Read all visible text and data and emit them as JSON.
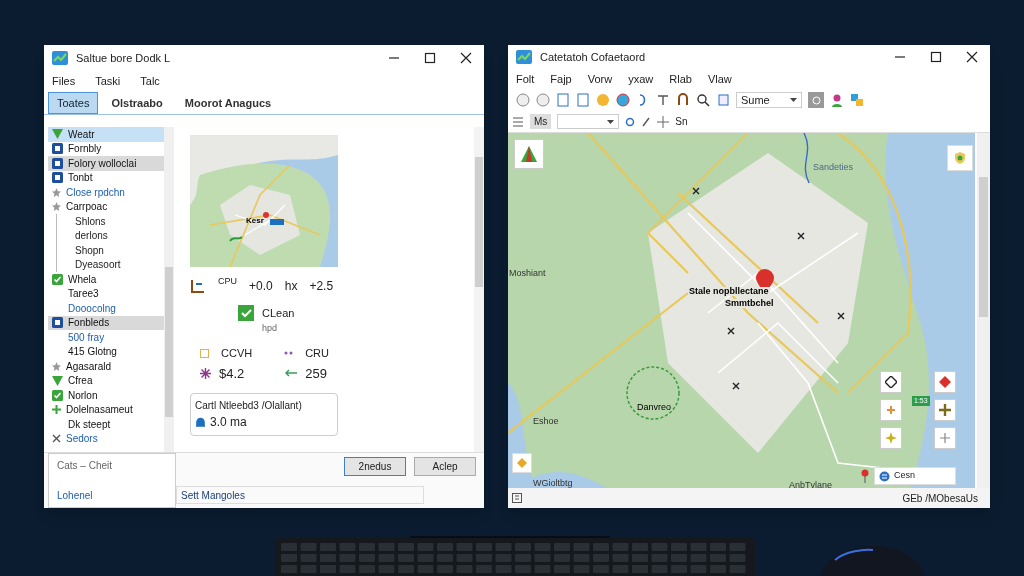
{
  "left_window": {
    "title": "Saltue bore Dodk L",
    "menu": [
      "Files",
      "Taski",
      "Talc"
    ],
    "tabs": [
      {
        "label": "Toates",
        "selected": true
      },
      {
        "label": "Olstraabo",
        "selected": false
      },
      {
        "label": "Moorot Anagucs",
        "selected": false
      }
    ],
    "tree": [
      {
        "label": "Weatr",
        "kind": "triangle",
        "selected": true,
        "highlighted": false,
        "link": false
      },
      {
        "label": "Fornbly",
        "kind": "square",
        "selected": false,
        "highlighted": false,
        "link": false
      },
      {
        "label": "Folory wolloclai",
        "kind": "square",
        "selected": false,
        "highlighted": true,
        "link": false
      },
      {
        "label": "Tonbt",
        "kind": "square",
        "selected": false,
        "highlighted": false,
        "link": false
      },
      {
        "label": "Close rpdchn",
        "kind": "star",
        "selected": false,
        "highlighted": false,
        "link": true
      },
      {
        "label": "Carrpoac",
        "kind": "star",
        "selected": false,
        "highlighted": false,
        "link": false,
        "children": [
          {
            "label": "Shlons"
          },
          {
            "label": "derlons"
          },
          {
            "label": "Shopn"
          },
          {
            "label": "Dyeasoort"
          }
        ]
      },
      {
        "label": "Whela",
        "kind": "check",
        "selected": false,
        "highlighted": false,
        "link": false
      },
      {
        "label": "Taree3",
        "kind": "none",
        "selected": false,
        "highlighted": false,
        "link": false
      },
      {
        "label": "Dooocolng",
        "kind": "none",
        "selected": false,
        "highlighted": false,
        "link": true
      },
      {
        "label": "Fonbleds",
        "kind": "square",
        "selected": false,
        "highlighted": true,
        "link": false
      },
      {
        "label": "500 fray",
        "kind": "none",
        "selected": false,
        "highlighted": false,
        "link": true
      },
      {
        "label": "415 Glotng",
        "kind": "none",
        "selected": false,
        "highlighted": false,
        "link": false
      },
      {
        "label": "Agasarald",
        "kind": "star",
        "selected": false,
        "highlighted": false,
        "link": false
      },
      {
        "label": "Cfrea",
        "kind": "triangle",
        "selected": false,
        "highlighted": false,
        "link": false
      },
      {
        "label": "Norlon",
        "kind": "check",
        "selected": false,
        "highlighted": false,
        "link": false
      },
      {
        "label": "Dolelnasameut",
        "kind": "plus",
        "selected": false,
        "highlighted": false,
        "link": false
      },
      {
        "label": "Dk steept",
        "kind": "none",
        "selected": false,
        "highlighted": false,
        "link": false
      },
      {
        "label": "Sedors",
        "kind": "cross",
        "selected": false,
        "highlighted": false,
        "link": true
      }
    ],
    "map_label": "Kesr",
    "metrics": [
      "CPU",
      "+0.0",
      "hx",
      "+2.5"
    ],
    "status": {
      "label": "CLean",
      "sub": "hpd",
      "checked": true
    },
    "stats": [
      {
        "label": "CCVH",
        "value": "$4.2"
      },
      {
        "label": "CRU",
        "value": "259"
      }
    ],
    "info_box": {
      "title": "Cartl Ntleebd3 /Olallant)",
      "value": "3.0 ma"
    },
    "bottom_tab": {
      "label": "Cats – Cheit",
      "link": "Lohenel"
    },
    "buttons": [
      {
        "label": "2nedus",
        "default": true
      },
      {
        "label": "Aclep",
        "default": false
      }
    ],
    "status_bar": "Sett Mangoles"
  },
  "right_window": {
    "title": "Catetatoh Cofaetaord",
    "menu": [
      "Folt",
      "Fajp",
      "Vorw",
      "yxaw",
      "Rlab",
      "Vlaw"
    ],
    "layer_select": "Sume",
    "toolbar2": [
      "Ms",
      "Sn"
    ],
    "map_labels": [
      "Sandeties",
      "Moshiant",
      "Stale nopbllectane",
      "Smmtbchel",
      "Danvreo",
      "Eshoe",
      "WGioltbtg",
      "AnbTvlane"
    ],
    "tag": "1:53",
    "popup": "Cesn",
    "status_bar": "GEb /MObesaUs"
  }
}
